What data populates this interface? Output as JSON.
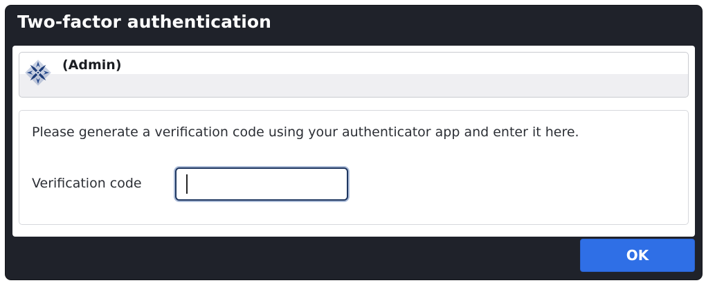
{
  "dialog": {
    "title": "Two-factor authentication"
  },
  "user": {
    "name": "(Admin)",
    "avatar_icon": "snowflake-logo-icon"
  },
  "form": {
    "instructions": "Please generate a verification code using your authenticator app and enter it here.",
    "code_label": "Verification code",
    "code_value": ""
  },
  "actions": {
    "ok_label": "OK"
  },
  "colors": {
    "dialog_background": "#1f222a",
    "primary_button": "#2f6fe6",
    "input_focus_border": "#1e3660"
  }
}
